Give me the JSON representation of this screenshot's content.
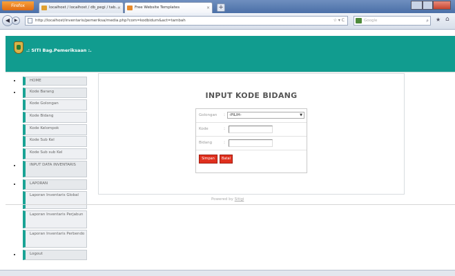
{
  "browser": {
    "button_label": "Firefox",
    "tabs": [
      {
        "label": "localhost / localhost / db_pegi / tab..."
      },
      {
        "label": "Free Website Templates"
      }
    ],
    "newtab_label": "+",
    "url": "http://localhost/inventaris/pemeriksa/media.php?com=kodbidum&act=tambah",
    "search_placeholder": "Google"
  },
  "header": {
    "title": ".: SITI Bag.Pemeriksaan :."
  },
  "sidebar": {
    "items": [
      {
        "label": "HOME"
      },
      {
        "label": "Kode Barang"
      },
      {
        "label": "Kode Golongan"
      },
      {
        "label": "Kode Bidang"
      },
      {
        "label": "Kode Kelompok"
      },
      {
        "label": "Kode Sub Kel"
      },
      {
        "label": "Kode Sub sub Kel"
      },
      {
        "label": "INPUT DATA INVENTARIS"
      },
      {
        "label": "LAPORAN"
      },
      {
        "label": "Laporan Inventaris Global"
      },
      {
        "label": "Laporan Inventaris Perjabun"
      },
      {
        "label": "Laporan Inventaris Perbendo"
      },
      {
        "label": "Logout"
      }
    ]
  },
  "form": {
    "title": "INPUT KODE BIDANG",
    "kategori_label": "Golongan",
    "kategori_value": "-PILIH-",
    "kode_label": "Kode",
    "bidang_label": "Bidang",
    "colon": ":",
    "save_label": "Simpan",
    "cancel_label": "Batal"
  },
  "footer": {
    "text": "Powered by",
    "link": "Sitigi"
  }
}
